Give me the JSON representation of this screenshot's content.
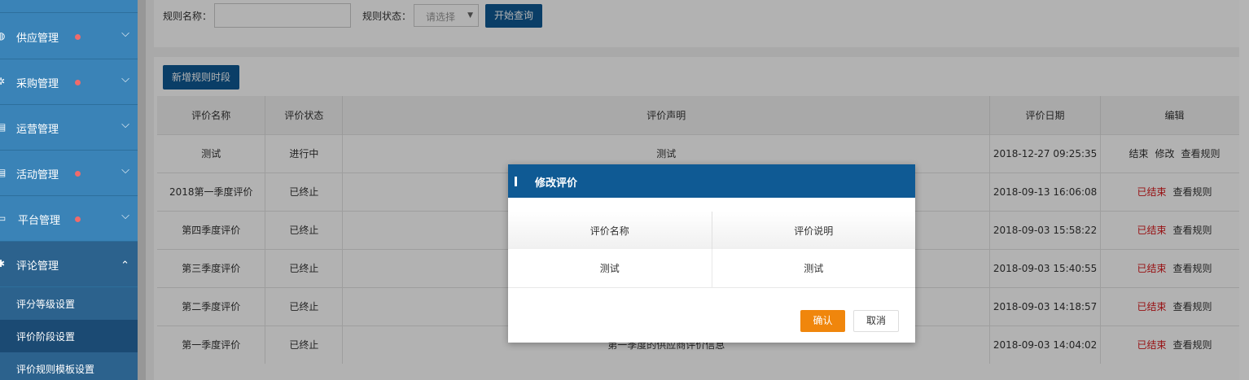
{
  "sidebar": {
    "items": [
      {
        "label": "供应管理",
        "icon": "truck-icon",
        "dot": true
      },
      {
        "label": "采购管理",
        "icon": "cart-icon",
        "dot": true
      },
      {
        "label": "运营管理",
        "icon": "document-icon",
        "dot": false
      },
      {
        "label": "活动管理",
        "icon": "calendar-icon",
        "dot": true
      },
      {
        "label": "平台管理",
        "icon": "monitor-icon",
        "dot": true
      },
      {
        "label": "评论管理",
        "icon": "gear-icon",
        "dot": false
      }
    ],
    "subitems": [
      {
        "label": "评分等级设置"
      },
      {
        "label": "评价阶段设置"
      },
      {
        "label": "评价规则模板设置"
      }
    ],
    "chevron_down": "⌵",
    "chevron_up": "⌃"
  },
  "filter": {
    "rule_name_label": "规则名称：",
    "rule_name_value": "",
    "rule_status_label": "规则状态：",
    "rule_status_value": "请选择",
    "search_button": "开始查询"
  },
  "toolbar": {
    "add_button": "新增规则时段"
  },
  "table": {
    "headers": [
      "评价名称",
      "评价状态",
      "评价声明",
      "评价日期",
      "编辑"
    ],
    "rows": [
      {
        "name": "测试",
        "status": "进行中",
        "statement": "测试",
        "date": "2018-12-27 09:25:35",
        "ops": [
          "结束",
          "修改",
          "查看规则"
        ]
      },
      {
        "name": "2018第一季度评价",
        "status": "已终止",
        "statement": "",
        "date": "2018-09-13 16:06:08",
        "ops": [
          "已结束",
          "查看规则"
        ]
      },
      {
        "name": "第四季度评价",
        "status": "已终止",
        "statement": "",
        "date": "2018-09-03 15:58:22",
        "ops": [
          "已结束",
          "查看规则"
        ]
      },
      {
        "name": "第三季度评价",
        "status": "已终止",
        "statement": "",
        "date": "2018-09-03 15:40:55",
        "ops": [
          "已结束",
          "查看规则"
        ]
      },
      {
        "name": "第二季度评价",
        "status": "已终止",
        "statement": "",
        "date": "2018-09-03 14:18:57",
        "ops": [
          "已结束",
          "查看规则"
        ]
      },
      {
        "name": "第一季度评价",
        "status": "已终止",
        "statement": "第一季度的供应商评价信息",
        "date": "2018-09-03 14:04:02",
        "ops": [
          "已结束",
          "查看规则"
        ]
      }
    ]
  },
  "modal": {
    "title": "修改评价",
    "headers": [
      "评价名称",
      "评价说明"
    ],
    "row": [
      "测试",
      "测试"
    ],
    "confirm": "确认",
    "cancel": "取消"
  },
  "colors": {
    "sidebar": "#3a83b7",
    "primary": "#0f5a94",
    "confirm": "#f0860c",
    "ended": "#d9191c"
  }
}
